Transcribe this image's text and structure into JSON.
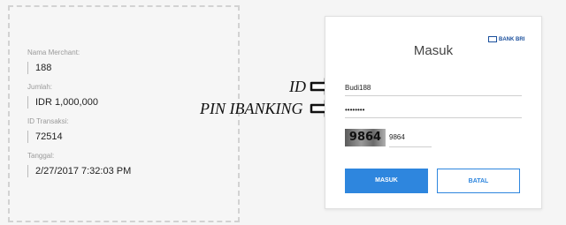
{
  "details": {
    "merchant_label": "Nama Merchant:",
    "merchant_value": "188",
    "amount_label": "Jumlah:",
    "amount_value": "IDR 1,000,000",
    "txn_label": "ID Transaksi:",
    "txn_value": "72514",
    "date_label": "Tanggal:",
    "date_value": "2/27/2017 7:32:03 PM"
  },
  "login": {
    "title": "Masuk",
    "bank_logo": "BANK BRI",
    "id_value": "Budi188",
    "pin_value": "••••••••",
    "captcha_image_text": "9864",
    "captcha_value": "9864",
    "submit_label": "MASUK",
    "cancel_label": "BATAL"
  },
  "annotations": {
    "id_label": "ID",
    "pin_label": "PIN IBANKING"
  },
  "colors": {
    "primary": "#2e86de",
    "brand": "#1a4f9c"
  },
  "icons": [
    "arrow-right-icon",
    "bank-logo-icon"
  ]
}
